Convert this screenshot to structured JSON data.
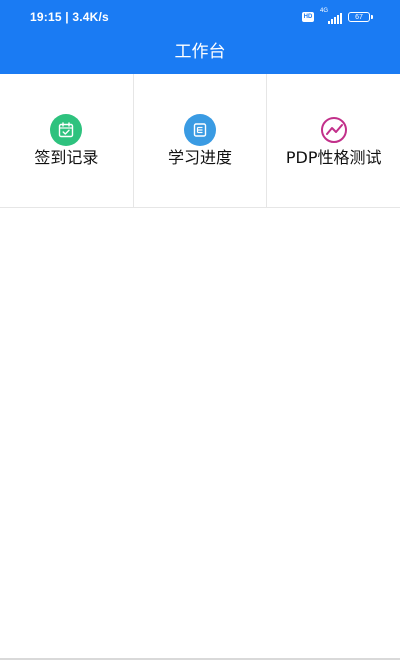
{
  "status_bar": {
    "time_speed": "19:15 | 3.4K/s",
    "hd_label": "HD",
    "network_label": "4G",
    "battery_level": "67"
  },
  "header": {
    "title": "工作台"
  },
  "grid": {
    "items": [
      {
        "label": "签到记录",
        "icon": "calendar-check-icon",
        "color": "#2ec27e"
      },
      {
        "label": "学习进度",
        "icon": "progress-icon",
        "color": "#3a9be3"
      },
      {
        "label": "PDP性格测试",
        "icon": "personality-test-icon",
        "color": "#c2308a"
      }
    ]
  },
  "colors": {
    "header_bg": "#1a7bf3"
  }
}
